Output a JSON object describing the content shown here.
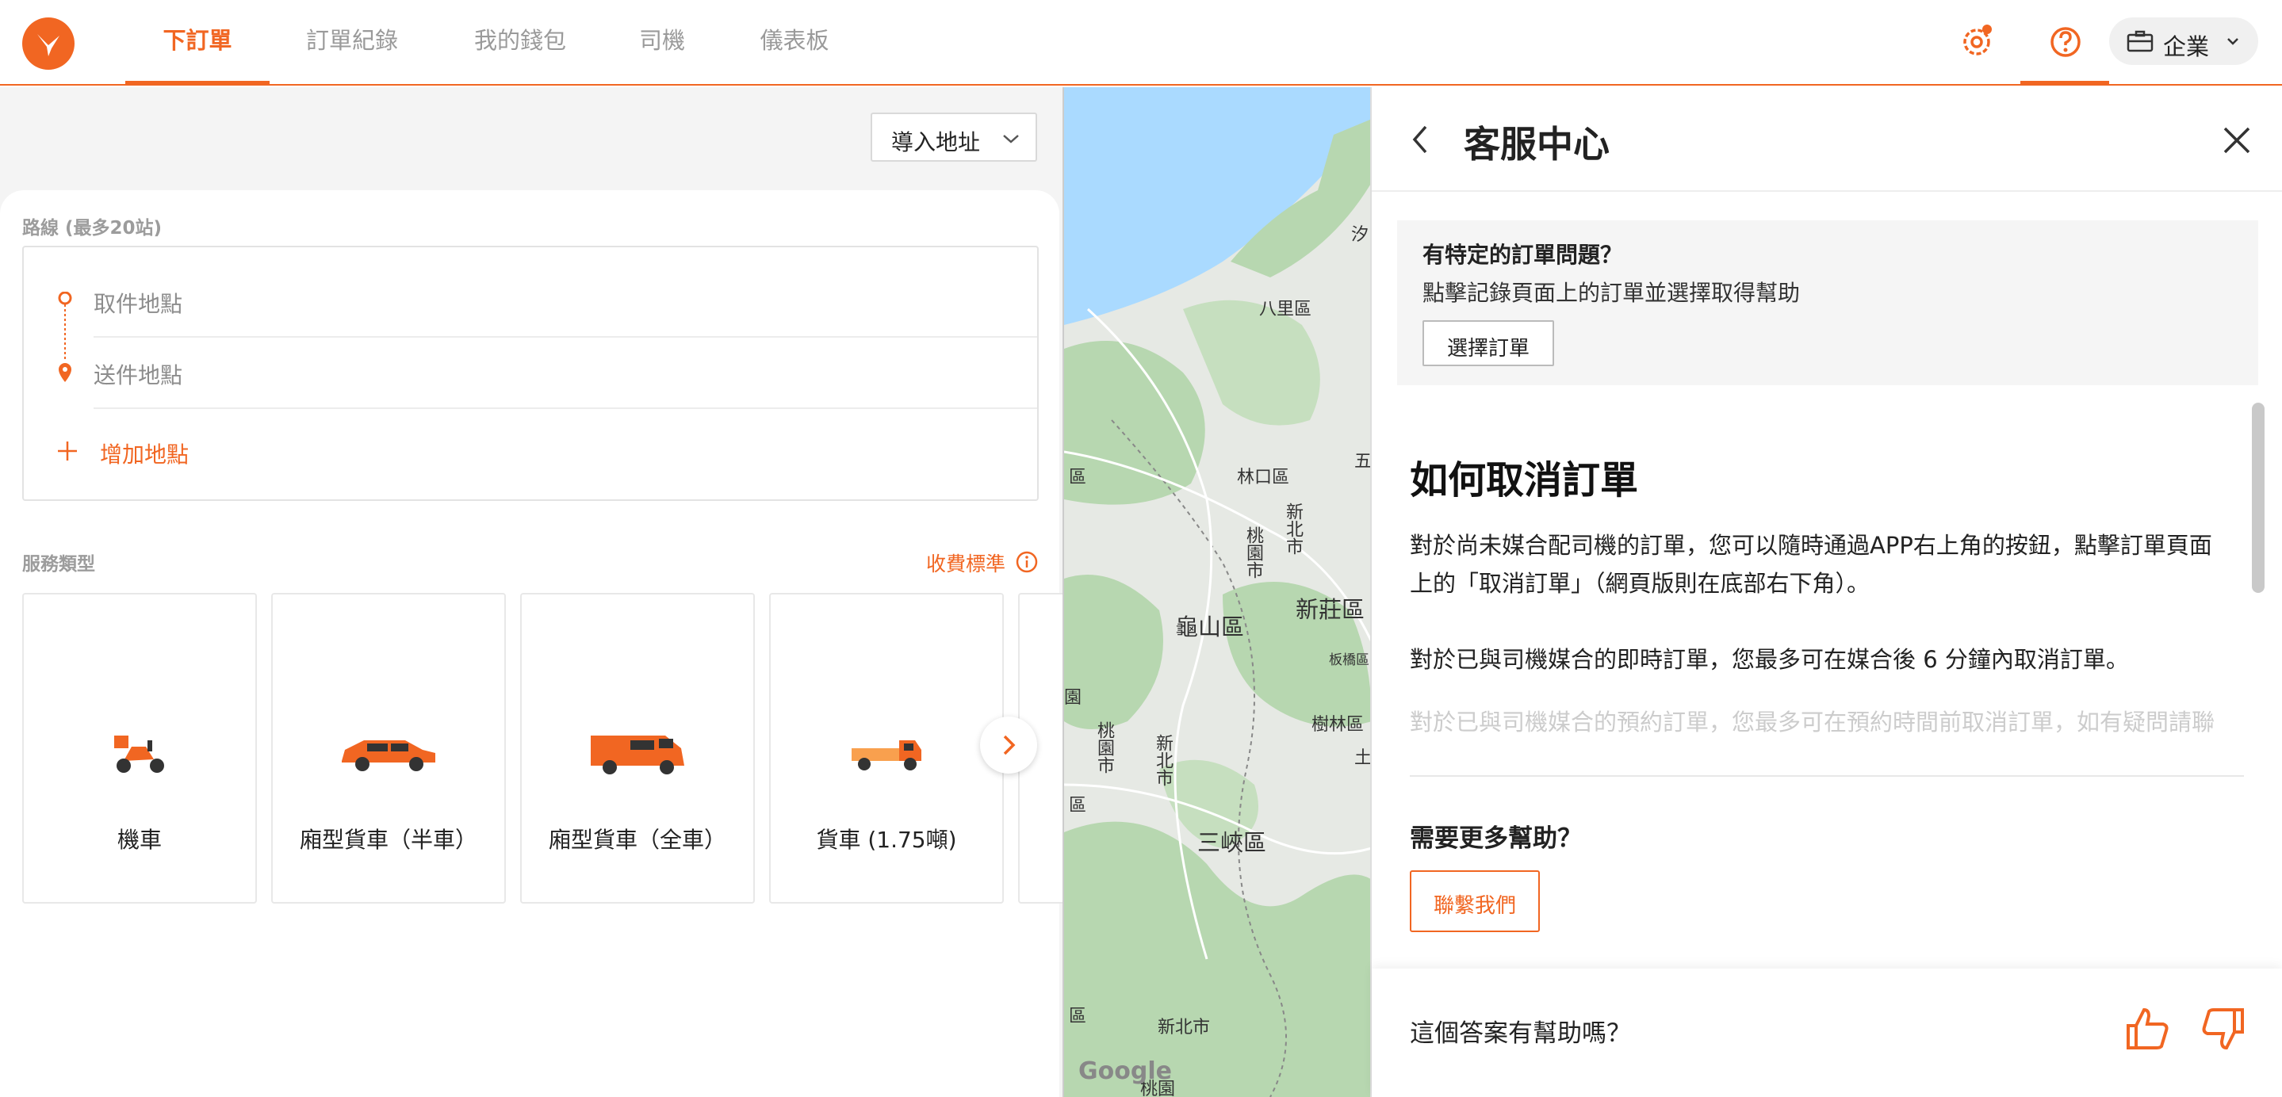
{
  "nav": {
    "tabs": [
      {
        "label": "下訂單",
        "active": true
      },
      {
        "label": "訂單紀錄",
        "active": false
      },
      {
        "label": "我的錢包",
        "active": false
      },
      {
        "label": "司機",
        "active": false
      },
      {
        "label": "儀表板",
        "active": false
      }
    ],
    "account_label": "企業",
    "icons": [
      "settings-gear-icon",
      "help-question-icon",
      "briefcase-icon",
      "chevron-down-icon"
    ]
  },
  "order": {
    "import_label": "導入地址",
    "route_label": "路線 (最多20站)",
    "pickup_placeholder": "取件地點",
    "dropoff_placeholder": "送件地點",
    "add_stop_label": "增加地點",
    "service_label": "服務類型",
    "fees_label": "收費標準",
    "services": [
      {
        "name": "機車",
        "icon": "motorcycle-icon"
      },
      {
        "name": "廂型貨車（半車）",
        "icon": "suv-icon"
      },
      {
        "name": "廂型貨車（全車）",
        "icon": "van-icon"
      },
      {
        "name": "貨車 (1.75噸)",
        "icon": "truck-icon"
      }
    ]
  },
  "map": {
    "labels": [
      "汐",
      "八里區",
      "五",
      "林口區",
      "新北市",
      "桃園市",
      "龜山區",
      "新莊區",
      "區",
      "土",
      "樹林區",
      "板橋區",
      "園",
      "桃園市",
      "新北市",
      "三峽區",
      "區",
      "新北市",
      "區",
      "桃園"
    ],
    "attribution": "Google"
  },
  "help": {
    "title": "客服中心",
    "order_question": "有特定的訂單問題？",
    "order_desc": "點擊記錄頁面上的訂單並選擇取得幫助",
    "select_order_label": "選擇訂單",
    "article_title": "如何取消訂單",
    "article_p1": "對於尚未媒合配司機的訂單，您可以隨時通過APP右上角的按鈕，點擊訂單頁面上的「取消訂單」（網頁版則在底部右下角）。",
    "article_p2": "對於已與司機媒合的即時訂單，您最多可在媒合後 6 分鐘內取消訂單。",
    "article_p3": "對於已與司機媒合的預約訂單，您最多可在預約時間前取消訂單，如有疑問請聯繫客服。",
    "more_help": "需要更多幫助？",
    "contact_label": "聯繫我們",
    "feedback_question": "這個答案有幫助嗎？"
  },
  "colors": {
    "accent": "#f16622",
    "map_green": "#b7d7b0",
    "map_water": "#aadaff"
  }
}
